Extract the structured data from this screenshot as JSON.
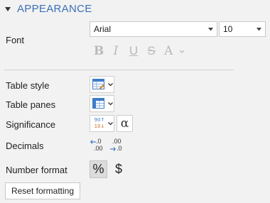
{
  "section": {
    "title": "APPEARANCE",
    "collapse_icon": "triangle-down-icon",
    "accent_color": "#3b6fb6"
  },
  "font": {
    "label": "Font",
    "family_value": "Arial",
    "size_value": "10",
    "style_buttons": [
      {
        "name": "bold",
        "glyph": "B"
      },
      {
        "name": "italic",
        "glyph": "I"
      },
      {
        "name": "underline",
        "glyph": "U"
      },
      {
        "name": "strikethrough",
        "glyph": "S"
      },
      {
        "name": "font-color",
        "glyph": "A"
      }
    ]
  },
  "rows": {
    "table_style": "Table style",
    "table_panes": "Table panes",
    "significance": "Significance",
    "decimals": "Decimals",
    "number_format": "Number format"
  },
  "controls": {
    "alpha_symbol": "α",
    "percent_symbol": "%",
    "dollar_symbol": "$",
    "significance_icon_top": "90↑",
    "significance_icon_bottom": "10↓",
    "decrease_decimals_top": ".0",
    "decrease_decimals_bottom": ".00",
    "increase_decimals_top": ".00",
    "increase_decimals_bottom": ".0"
  },
  "reset_button": "Reset formatting"
}
